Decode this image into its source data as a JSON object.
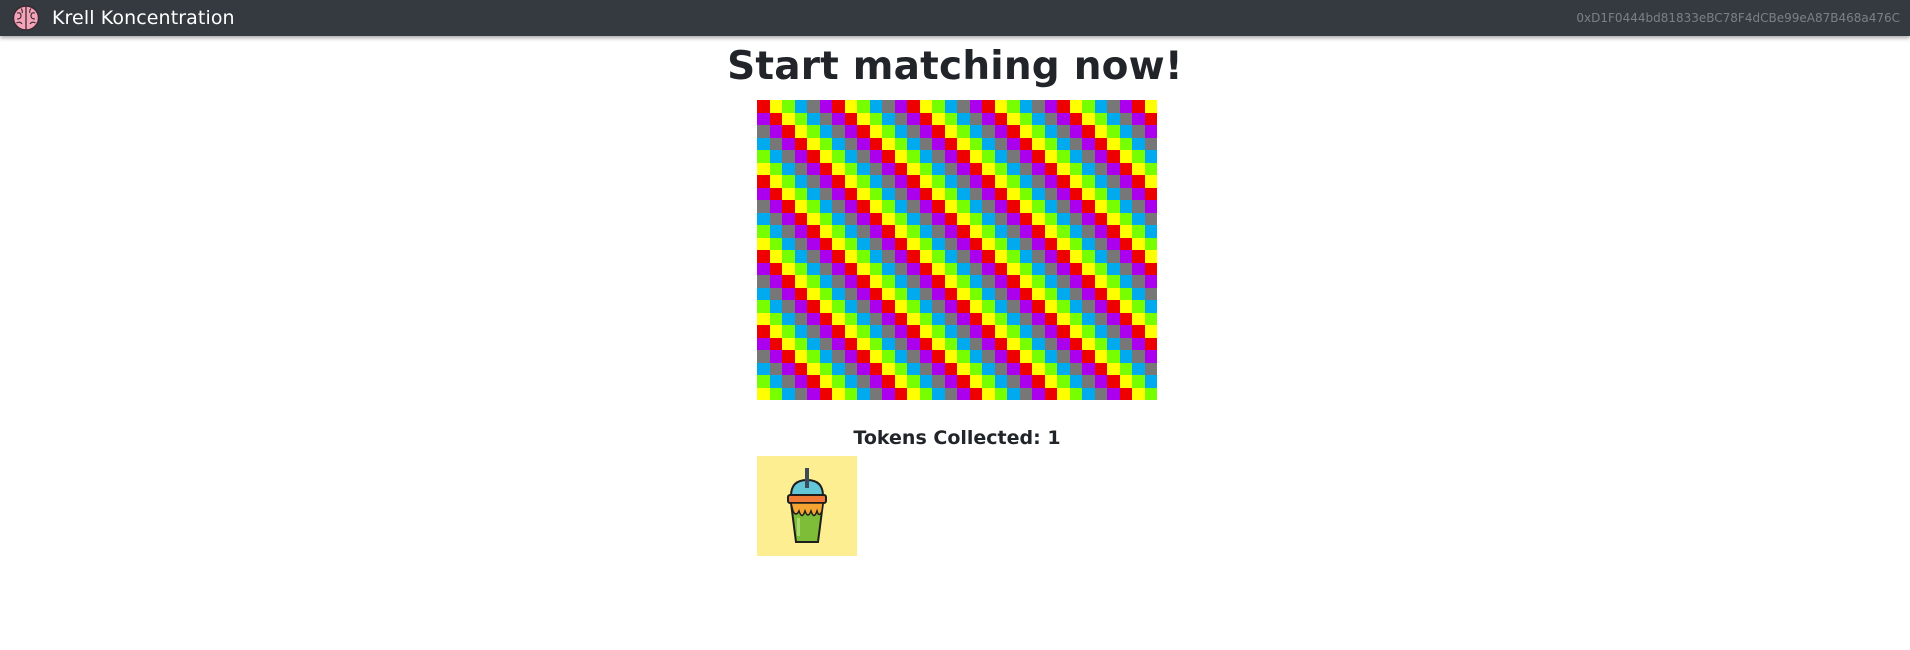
{
  "navbar": {
    "brand_icon": "brain-icon",
    "brand_label": "Krell Koncentration",
    "account_address": "0xD1F0444bd81833eBC78F4dCBe99eA87B468a476C"
  },
  "main": {
    "title": "Start matching now!",
    "board": {
      "columns": 32,
      "rows": 24,
      "palette": [
        "#ee0000",
        "#ffff00",
        "#77ff00",
        "#00aaee",
        "#777777",
        "#aa00ee"
      ]
    },
    "tokens": {
      "label": "Tokens Collected: 1",
      "items": [
        {
          "icon": "slushie-cup-icon",
          "background": "#fdee91"
        }
      ]
    }
  }
}
